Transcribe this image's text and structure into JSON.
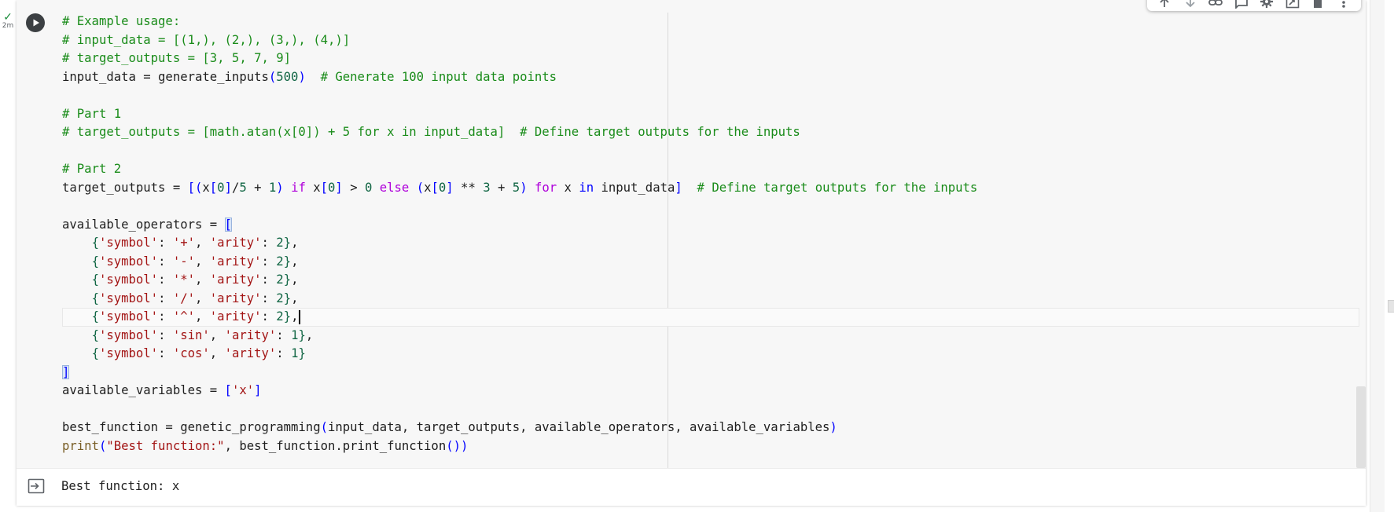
{
  "exec_status": {
    "check": "✓",
    "time": "2m"
  },
  "code_lines": [
    [
      {
        "t": "# Example usage:",
        "c": "cm"
      }
    ],
    [
      {
        "t": "# input_data = [(1,), (2,), (3,), (4,)]",
        "c": "cm"
      }
    ],
    [
      {
        "t": "# target_outputs = [3, 5, 7, 9]",
        "c": "cm"
      }
    ],
    [
      {
        "t": "input_data = generate_inputs"
      },
      {
        "t": "(",
        "c": "bl"
      },
      {
        "t": "500",
        "c": "nu"
      },
      {
        "t": ")",
        "c": "bl"
      },
      {
        "t": "  "
      },
      {
        "t": "# Generate 100 input data points",
        "c": "cm"
      }
    ],
    [],
    [
      {
        "t": "# Part 1",
        "c": "cm"
      }
    ],
    [
      {
        "t": "# target_outputs = [math.atan(x[0]) + 5 for x in input_data]  # Define target outputs for the inputs",
        "c": "cm"
      }
    ],
    [],
    [
      {
        "t": "# Part 2",
        "c": "cm"
      }
    ],
    [
      {
        "t": "target_outputs = "
      },
      {
        "t": "[(",
        "c": "bl"
      },
      {
        "t": "x"
      },
      {
        "t": "[",
        "c": "bl"
      },
      {
        "t": "0",
        "c": "nu"
      },
      {
        "t": "]",
        "c": "bl"
      },
      {
        "t": "/"
      },
      {
        "t": "5",
        "c": "nu"
      },
      {
        "t": " + "
      },
      {
        "t": "1",
        "c": "nu"
      },
      {
        "t": ")",
        "c": "bl"
      },
      {
        "t": " "
      },
      {
        "t": "if",
        "c": "kw"
      },
      {
        "t": " x"
      },
      {
        "t": "[",
        "c": "bl"
      },
      {
        "t": "0",
        "c": "nu"
      },
      {
        "t": "]",
        "c": "bl"
      },
      {
        "t": " > "
      },
      {
        "t": "0",
        "c": "nu"
      },
      {
        "t": " "
      },
      {
        "t": "else",
        "c": "kw"
      },
      {
        "t": " "
      },
      {
        "t": "(",
        "c": "bl"
      },
      {
        "t": "x"
      },
      {
        "t": "[",
        "c": "bl"
      },
      {
        "t": "0",
        "c": "nu"
      },
      {
        "t": "]",
        "c": "bl"
      },
      {
        "t": " ** "
      },
      {
        "t": "3",
        "c": "nu"
      },
      {
        "t": " + "
      },
      {
        "t": "5",
        "c": "nu"
      },
      {
        "t": ")",
        "c": "bl"
      },
      {
        "t": " "
      },
      {
        "t": "for",
        "c": "kw"
      },
      {
        "t": " x "
      },
      {
        "t": "in",
        "c": "bl"
      },
      {
        "t": " input_data"
      },
      {
        "t": "]",
        "c": "bl"
      },
      {
        "t": "  "
      },
      {
        "t": "# Define target outputs for the inputs",
        "c": "cm"
      }
    ],
    [],
    [
      {
        "t": "available_operators = "
      },
      {
        "t": "[",
        "c": "bl br"
      }
    ],
    [
      {
        "t": "    "
      },
      {
        "t": "{",
        "c": "nu"
      },
      {
        "t": "'symbol'",
        "c": "st"
      },
      {
        "t": ": "
      },
      {
        "t": "'+'",
        "c": "st"
      },
      {
        "t": ", "
      },
      {
        "t": "'arity'",
        "c": "st"
      },
      {
        "t": ": "
      },
      {
        "t": "2",
        "c": "nu"
      },
      {
        "t": "}",
        "c": "nu"
      },
      {
        "t": ","
      }
    ],
    [
      {
        "t": "    "
      },
      {
        "t": "{",
        "c": "nu"
      },
      {
        "t": "'symbol'",
        "c": "st"
      },
      {
        "t": ": "
      },
      {
        "t": "'-'",
        "c": "st"
      },
      {
        "t": ", "
      },
      {
        "t": "'arity'",
        "c": "st"
      },
      {
        "t": ": "
      },
      {
        "t": "2",
        "c": "nu"
      },
      {
        "t": "}",
        "c": "nu"
      },
      {
        "t": ","
      }
    ],
    [
      {
        "t": "    "
      },
      {
        "t": "{",
        "c": "nu"
      },
      {
        "t": "'symbol'",
        "c": "st"
      },
      {
        "t": ": "
      },
      {
        "t": "'*'",
        "c": "st"
      },
      {
        "t": ", "
      },
      {
        "t": "'arity'",
        "c": "st"
      },
      {
        "t": ": "
      },
      {
        "t": "2",
        "c": "nu"
      },
      {
        "t": "}",
        "c": "nu"
      },
      {
        "t": ","
      }
    ],
    [
      {
        "t": "    "
      },
      {
        "t": "{",
        "c": "nu"
      },
      {
        "t": "'symbol'",
        "c": "st"
      },
      {
        "t": ": "
      },
      {
        "t": "'/'",
        "c": "st"
      },
      {
        "t": ", "
      },
      {
        "t": "'arity'",
        "c": "st"
      },
      {
        "t": ": "
      },
      {
        "t": "2",
        "c": "nu"
      },
      {
        "t": "}",
        "c": "nu"
      },
      {
        "t": ","
      }
    ],
    [
      {
        "t": "    "
      },
      {
        "t": "{",
        "c": "nu"
      },
      {
        "t": "'symbol'",
        "c": "st"
      },
      {
        "t": ": "
      },
      {
        "t": "'^'",
        "c": "st"
      },
      {
        "t": ", "
      },
      {
        "t": "'arity'",
        "c": "st"
      },
      {
        "t": ": "
      },
      {
        "t": "2",
        "c": "nu"
      },
      {
        "t": "}",
        "c": "nu"
      },
      {
        "t": ","
      }
    ],
    [
      {
        "t": "    "
      },
      {
        "t": "{",
        "c": "nu"
      },
      {
        "t": "'symbol'",
        "c": "st"
      },
      {
        "t": ": "
      },
      {
        "t": "'sin'",
        "c": "st"
      },
      {
        "t": ", "
      },
      {
        "t": "'arity'",
        "c": "st"
      },
      {
        "t": ": "
      },
      {
        "t": "1",
        "c": "nu"
      },
      {
        "t": "}",
        "c": "nu"
      },
      {
        "t": ","
      }
    ],
    [
      {
        "t": "    "
      },
      {
        "t": "{",
        "c": "nu"
      },
      {
        "t": "'symbol'",
        "c": "st"
      },
      {
        "t": ": "
      },
      {
        "t": "'cos'",
        "c": "st"
      },
      {
        "t": ", "
      },
      {
        "t": "'arity'",
        "c": "st"
      },
      {
        "t": ": "
      },
      {
        "t": "1",
        "c": "nu"
      },
      {
        "t": "}",
        "c": "nu"
      }
    ],
    [
      {
        "t": "]",
        "c": "bl br"
      }
    ],
    [
      {
        "t": "available_variables = "
      },
      {
        "t": "[",
        "c": "bl"
      },
      {
        "t": "'x'",
        "c": "st"
      },
      {
        "t": "]",
        "c": "bl"
      }
    ],
    [],
    [
      {
        "t": "best_function = genetic_programming"
      },
      {
        "t": "(",
        "c": "bl"
      },
      {
        "t": "input_data, target_outputs, available_operators, available_variables"
      },
      {
        "t": ")",
        "c": "bl"
      }
    ],
    [
      {
        "t": "print",
        "c": "fn"
      },
      {
        "t": "(",
        "c": "bl"
      },
      {
        "t": "\"Best function:\"",
        "c": "st"
      },
      {
        "t": ", best_function.print_function"
      },
      {
        "t": "())",
        "c": "bl"
      }
    ]
  ],
  "active_line": 16,
  "output": {
    "text": "Best function: x"
  },
  "toolbar_icons": [
    "move-up-icon",
    "move-down-icon",
    "link-icon",
    "comment-icon",
    "gear-icon",
    "mirror-cell-icon",
    "delete-icon",
    "more-vert-icon"
  ]
}
